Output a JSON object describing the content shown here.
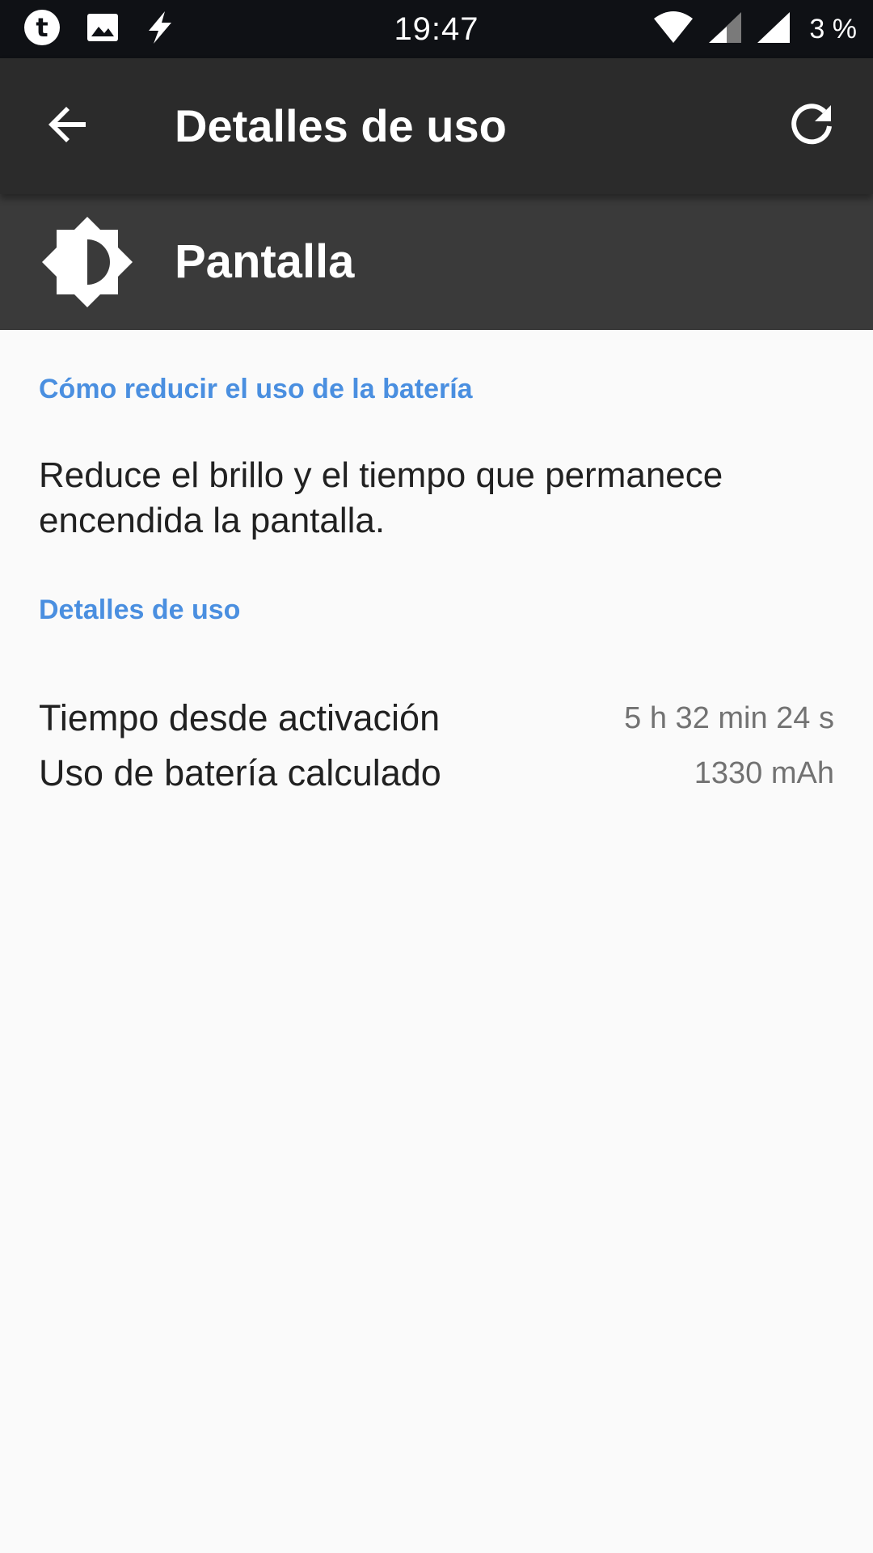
{
  "status_bar": {
    "time": "19:47",
    "battery": "3 %",
    "left_icons": [
      "tumblr-icon",
      "image-icon",
      "flash-icon"
    ],
    "right_icons": [
      "wifi-icon",
      "signal-icon",
      "signal-icon"
    ]
  },
  "toolbar": {
    "title": "Detalles de uso",
    "back_icon": "arrow-left-icon",
    "refresh_icon": "refresh-icon"
  },
  "app_header": {
    "name": "Pantalla",
    "icon": "brightness-icon"
  },
  "tips": {
    "header": "Cómo reducir el uso de la batería",
    "text": "Reduce el brillo y el tiempo que permanece encendida la pantalla."
  },
  "usage": {
    "header": "Detalles de uso",
    "rows": [
      {
        "label": "Tiempo desde activación",
        "value": "5 h 32 min 24 s"
      },
      {
        "label": "Uso de batería calculado",
        "value": "1330 mAh"
      }
    ]
  },
  "colors": {
    "status_bar": "#0f1115",
    "toolbar": "#2b2b2b",
    "app_header": "#3a3a3a",
    "accent": "#4a8fe0",
    "background": "#fafafa"
  }
}
